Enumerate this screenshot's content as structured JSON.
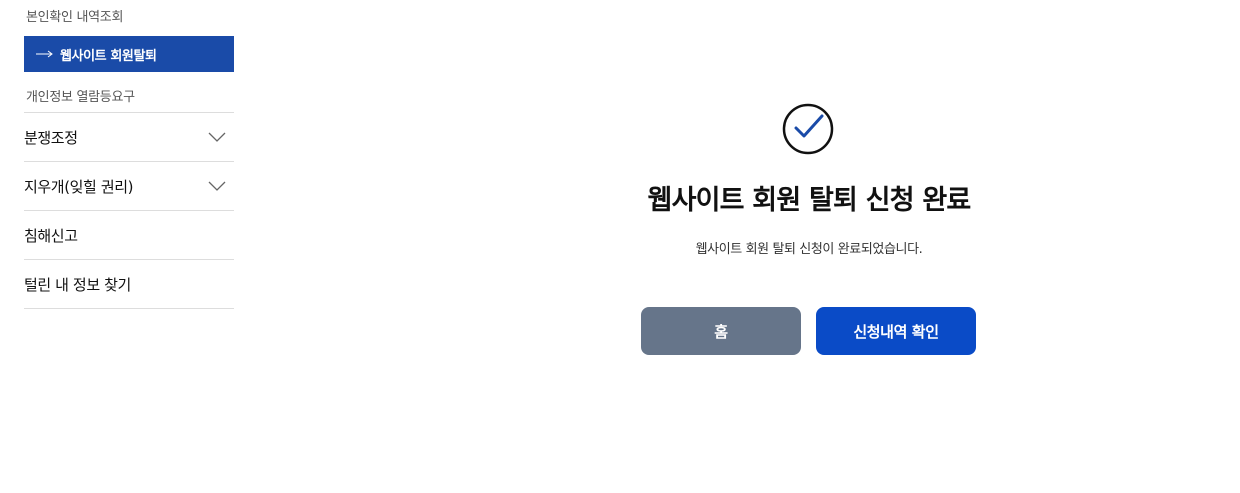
{
  "sidebar": {
    "sub_top": "본인확인 내역조회",
    "active_item": "웹사이트 회원탈퇴",
    "sub_bottom": "개인정보 열람등요구",
    "menu": [
      {
        "label": "분쟁조정",
        "expandable": true
      },
      {
        "label": "지우개(잊힐 권리)",
        "expandable": true
      },
      {
        "label": "침해신고",
        "expandable": false
      },
      {
        "label": "털린 내 정보 찾기",
        "expandable": false
      }
    ]
  },
  "main": {
    "icon": "check-circle-icon",
    "title": "웹사이트 회원 탈퇴 신청 완료",
    "description": "웹사이트 회원 탈퇴 신청이 완료되었습니다.",
    "buttons": {
      "home": "홈",
      "check_history": "신청내역 확인"
    }
  },
  "colors": {
    "active_bg": "#1a4ba8",
    "home_button": "#66758a",
    "primary_button": "#0a4bc7",
    "check_accent": "#1a4ba8"
  }
}
